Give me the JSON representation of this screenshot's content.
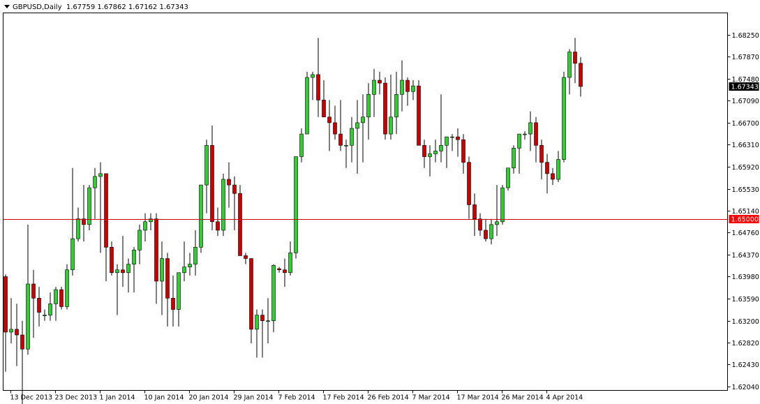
{
  "header": {
    "symbol_timeframe": "GBPUSD,Daily",
    "ohlc_text": "1.67759 1.67862 1.67162 1.67343"
  },
  "colors": {
    "background": "#ffffff",
    "axis": "#000000",
    "bull_fill": "#32cd32",
    "bear_fill": "#cc0000",
    "candle_outline": "#000000",
    "hline": "#cc0000",
    "price_tag_bg": "#000000",
    "hline_tag_bg": "#ff0000"
  },
  "chart_data": {
    "type": "candlestick",
    "symbol": "GBPUSD",
    "timeframe": "Daily",
    "ylim": [
      1.6197,
      1.6864
    ],
    "y_ticks": [
      "1.68250",
      "1.67870",
      "1.67480",
      "1.67090",
      "1.66700",
      "1.66310",
      "1.65920",
      "1.65530",
      "1.65140",
      "1.64760",
      "1.64370",
      "1.63980",
      "1.63590",
      "1.63200",
      "1.62820",
      "1.62430",
      "1.62040"
    ],
    "x_ticks": [
      {
        "index": 1,
        "label": "13 Dec 2013"
      },
      {
        "index": 9,
        "label": "23 Dec 2013"
      },
      {
        "index": 17,
        "label": "1 Jan 2014"
      },
      {
        "index": 25,
        "label": "10 Jan 2014"
      },
      {
        "index": 33,
        "label": "20 Jan 2014"
      },
      {
        "index": 41,
        "label": "29 Jan 2014"
      },
      {
        "index": 49,
        "label": "7 Feb 2014"
      },
      {
        "index": 57,
        "label": "17 Feb 2014"
      },
      {
        "index": 65,
        "label": "26 Feb 2014"
      },
      {
        "index": 73,
        "label": "7 Mar 2014"
      },
      {
        "index": 81,
        "label": "17 Mar 2014"
      },
      {
        "index": 89,
        "label": "26 Mar 2014"
      },
      {
        "index": 97,
        "label": "4 Apr 2014"
      }
    ],
    "candles": [
      [
        1.6398,
        1.6402,
        1.623,
        1.63
      ],
      [
        1.63,
        1.636,
        1.628,
        1.6305
      ],
      [
        1.6305,
        1.635,
        1.624,
        1.6295
      ],
      [
        1.6295,
        1.632,
        1.615,
        1.627
      ],
      [
        1.627,
        1.649,
        1.626,
        1.6385
      ],
      [
        1.6385,
        1.641,
        1.629,
        1.636
      ],
      [
        1.636,
        1.638,
        1.631,
        1.6335
      ],
      [
        1.633,
        1.634,
        1.632,
        1.633
      ],
      [
        1.633,
        1.637,
        1.632,
        1.635
      ],
      [
        1.635,
        1.638,
        1.632,
        1.6375
      ],
      [
        1.6375,
        1.638,
        1.634,
        1.6345
      ],
      [
        1.6345,
        1.642,
        1.634,
        1.641
      ],
      [
        1.641,
        1.659,
        1.64,
        1.6465
      ],
      [
        1.6465,
        1.652,
        1.646,
        1.65
      ],
      [
        1.65,
        1.656,
        1.646,
        1.649
      ],
      [
        1.649,
        1.656,
        1.648,
        1.6555
      ],
      [
        1.6555,
        1.659,
        1.65,
        1.6575
      ],
      [
        1.6575,
        1.66,
        1.644,
        1.658
      ],
      [
        1.658,
        1.658,
        1.639,
        1.645
      ],
      [
        1.645,
        1.646,
        1.64,
        1.6405
      ],
      [
        1.6405,
        1.642,
        1.633,
        1.641
      ],
      [
        1.641,
        1.647,
        1.638,
        1.6405
      ],
      [
        1.6405,
        1.643,
        1.637,
        1.642
      ],
      [
        1.642,
        1.645,
        1.637,
        1.6445
      ],
      [
        1.6445,
        1.649,
        1.642,
        1.648
      ],
      [
        1.648,
        1.651,
        1.646,
        1.6495
      ],
      [
        1.6495,
        1.651,
        1.648,
        1.65
      ],
      [
        1.65,
        1.651,
        1.635,
        1.639
      ],
      [
        1.639,
        1.646,
        1.633,
        1.643
      ],
      [
        1.643,
        1.644,
        1.631,
        1.636
      ],
      [
        1.636,
        1.64,
        1.631,
        1.634
      ],
      [
        1.634,
        1.64,
        1.631,
        1.6405
      ],
      [
        1.6405,
        1.646,
        1.639,
        1.6415
      ],
      [
        1.6415,
        1.644,
        1.64,
        1.642
      ],
      [
        1.642,
        1.648,
        1.64,
        1.645
      ],
      [
        1.645,
        1.656,
        1.644,
        1.656
      ],
      [
        1.656,
        1.664,
        1.651,
        1.663
      ],
      [
        1.663,
        1.6665,
        1.648,
        1.6495
      ],
      [
        1.6495,
        1.652,
        1.647,
        1.648
      ],
      [
        1.648,
        1.658,
        1.647,
        1.657
      ],
      [
        1.657,
        1.66,
        1.652,
        1.656
      ],
      [
        1.656,
        1.6575,
        1.648,
        1.6545
      ],
      [
        1.6545,
        1.656,
        1.644,
        1.6435
      ],
      [
        1.6435,
        1.644,
        1.642,
        1.643
      ],
      [
        1.643,
        1.643,
        1.628,
        1.6305
      ],
      [
        1.6305,
        1.634,
        1.6255,
        1.633
      ],
      [
        1.633,
        1.634,
        1.6255,
        1.632
      ],
      [
        1.632,
        1.636,
        1.628,
        1.632
      ],
      [
        1.632,
        1.642,
        1.63,
        1.6418
      ],
      [
        1.6412,
        1.6415,
        1.6405,
        1.641
      ],
      [
        1.641,
        1.643,
        1.638,
        1.6405
      ],
      [
        1.6405,
        1.646,
        1.64,
        1.644
      ],
      [
        1.644,
        1.661,
        1.643,
        1.661
      ],
      [
        1.661,
        1.666,
        1.66,
        1.665
      ],
      [
        1.665,
        1.676,
        1.665,
        1.675
      ],
      [
        1.675,
        1.676,
        1.671,
        1.6755
      ],
      [
        1.6755,
        1.682,
        1.668,
        1.671
      ],
      [
        1.671,
        1.6745,
        1.668,
        1.668
      ],
      [
        1.668,
        1.671,
        1.662,
        1.667
      ],
      [
        1.667,
        1.67,
        1.664,
        1.665
      ],
      [
        1.665,
        1.671,
        1.662,
        1.663
      ],
      [
        1.663,
        1.664,
        1.659,
        1.663
      ],
      [
        1.663,
        1.668,
        1.66,
        1.666
      ],
      [
        1.666,
        1.671,
        1.658,
        1.667
      ],
      [
        1.667,
        1.672,
        1.66,
        1.668
      ],
      [
        1.668,
        1.674,
        1.664,
        1.672
      ],
      [
        1.672,
        1.6765,
        1.668,
        1.6745
      ],
      [
        1.6745,
        1.676,
        1.672,
        1.674
      ],
      [
        1.674,
        1.675,
        1.664,
        1.665
      ],
      [
        1.665,
        1.6755,
        1.664,
        1.668
      ],
      [
        1.668,
        1.676,
        1.665,
        1.672
      ],
      [
        1.672,
        1.678,
        1.669,
        1.6745
      ],
      [
        1.6745,
        1.675,
        1.67,
        1.6725
      ],
      [
        1.6725,
        1.6745,
        1.671,
        1.6735
      ],
      [
        1.6735,
        1.6745,
        1.663,
        1.663
      ],
      [
        1.663,
        1.664,
        1.659,
        1.661
      ],
      [
        1.661,
        1.663,
        1.6575,
        1.6615
      ],
      [
        1.6615,
        1.664,
        1.66,
        1.662
      ],
      [
        1.662,
        1.672,
        1.66,
        1.663
      ],
      [
        1.663,
        1.664,
        1.659,
        1.6645
      ],
      [
        1.6645,
        1.665,
        1.662,
        1.6645
      ],
      [
        1.6645,
        1.666,
        1.661,
        1.664
      ],
      [
        1.664,
        1.665,
        1.658,
        1.66
      ],
      [
        1.66,
        1.661,
        1.65,
        1.6525
      ],
      [
        1.6525,
        1.6545,
        1.647,
        1.65
      ],
      [
        1.65,
        1.651,
        1.647,
        1.648
      ],
      [
        1.648,
        1.65,
        1.646,
        1.6465
      ],
      [
        1.6465,
        1.65,
        1.6455,
        1.649
      ],
      [
        1.649,
        1.656,
        1.647,
        1.6495
      ],
      [
        1.6495,
        1.656,
        1.649,
        1.6555
      ],
      [
        1.6555,
        1.659,
        1.655,
        1.659
      ],
      [
        1.659,
        1.663,
        1.658,
        1.6625
      ],
      [
        1.6625,
        1.665,
        1.658,
        1.665
      ],
      [
        1.665,
        1.6655,
        1.664,
        1.665
      ],
      [
        1.665,
        1.669,
        1.662,
        1.667
      ],
      [
        1.667,
        1.668,
        1.66,
        1.663
      ],
      [
        1.663,
        1.664,
        1.657,
        1.66
      ],
      [
        1.66,
        1.6615,
        1.6545,
        1.658
      ],
      [
        1.658,
        1.659,
        1.656,
        1.657
      ],
      [
        1.657,
        1.662,
        1.6565,
        1.6605
      ],
      [
        1.6605,
        1.676,
        1.66,
        1.675
      ],
      [
        1.675,
        1.68,
        1.672,
        1.6795
      ],
      [
        1.6795,
        1.682,
        1.674,
        1.6775
      ],
      [
        1.6775,
        1.6786,
        1.6716,
        1.6734
      ]
    ],
    "current_price_label": "1.67343",
    "hline": {
      "value": 1.65,
      "label": "1.65000"
    }
  }
}
